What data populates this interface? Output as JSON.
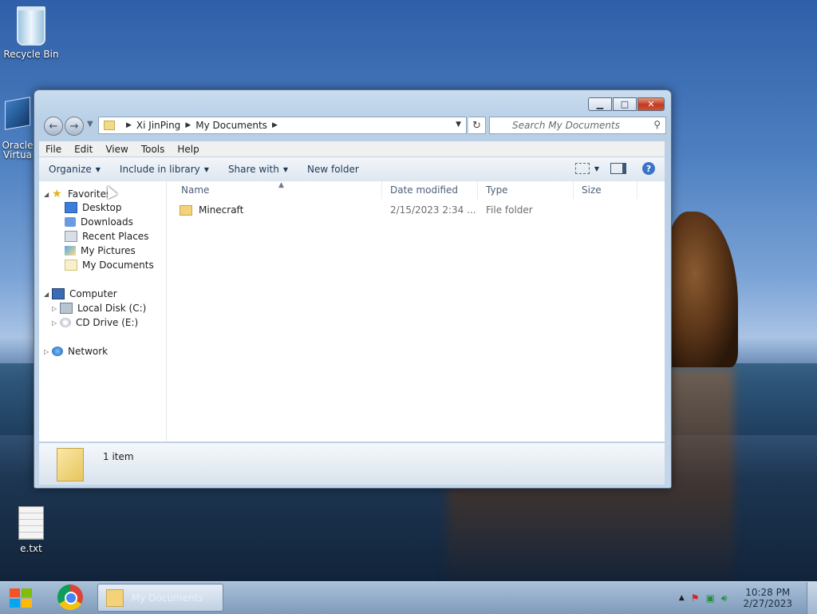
{
  "desktop": {
    "icons": [
      {
        "label": "Recycle Bin"
      },
      {
        "label": "Oracle\nVirtua"
      },
      {
        "label": "e.txt"
      }
    ]
  },
  "window": {
    "address": {
      "crumbs": [
        "Xi JinPing",
        "My Documents"
      ],
      "search_placeholder": "Search My Documents"
    },
    "menu": [
      "File",
      "Edit",
      "View",
      "Tools",
      "Help"
    ],
    "commands": {
      "organize": "Organize",
      "include_in_library": "Include in library",
      "share_with": "Share with",
      "new_folder": "New folder"
    },
    "nav": {
      "favorites": "Favorites",
      "desktop": "Desktop",
      "downloads": "Downloads",
      "recent_places": "Recent Places",
      "my_pictures": "My Pictures",
      "my_documents": "My Documents",
      "computer": "Computer",
      "local_disk": "Local Disk (C:)",
      "cd_drive": "CD Drive (E:)",
      "network": "Network"
    },
    "columns": {
      "name": "Name",
      "date_modified": "Date modified",
      "type": "Type",
      "size": "Size"
    },
    "items": [
      {
        "name": "Minecraft",
        "date_modified": "2/15/2023 2:34 ...",
        "type": "File folder",
        "size": ""
      }
    ],
    "details": {
      "count": "1 item"
    }
  },
  "taskbar": {
    "active_window": "My Documents",
    "time": "10:28 PM",
    "date": "2/27/2023"
  }
}
